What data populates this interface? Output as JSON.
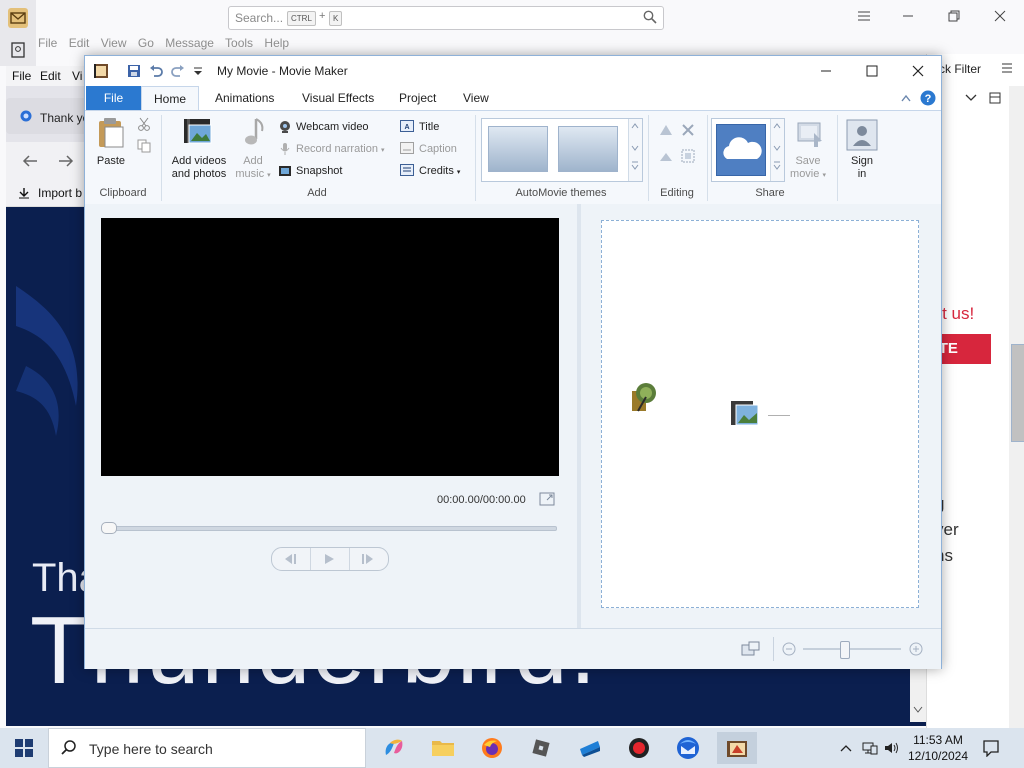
{
  "thunderbird": {
    "search_placeholder": "Search...",
    "shortcut_ctrl": "CTRL",
    "shortcut_plus": "+",
    "shortcut_k": "K",
    "menu": [
      "File",
      "Edit",
      "View",
      "Go",
      "Message",
      "Tools",
      "Help"
    ],
    "quick_filter": "ck Filter",
    "support_text": "ort us!",
    "donate_text": "ATE",
    "fragments": [
      "g",
      "ver",
      "ns"
    ]
  },
  "browser": {
    "menu": [
      "File",
      "Edit",
      "Vi"
    ],
    "tab_label": "Thank yo",
    "import_label": "Import b",
    "hero_line1": "Tha",
    "hero_line2": "Thunderbird."
  },
  "moviemaker": {
    "title": "My Movie - Movie Maker",
    "tabs": [
      "File",
      "Home",
      "Animations",
      "Visual Effects",
      "Project",
      "View"
    ],
    "clipboard": {
      "paste": "Paste",
      "group": "Clipboard"
    },
    "add": {
      "add_videos_line1": "Add videos",
      "add_videos_line2": "and photos",
      "add_music_line1": "Add",
      "add_music_line2": "music",
      "webcam": "Webcam video",
      "narration": "Record narration",
      "snapshot": "Snapshot",
      "title": "Title",
      "caption": "Caption",
      "credits": "Credits",
      "group": "Add"
    },
    "themes_group": "AutoMovie themes",
    "editing_group": "Editing",
    "share": {
      "save_line1": "Save",
      "save_line2": "movie",
      "signin_line1": "Sign",
      "signin_line2": "in",
      "group": "Share"
    },
    "timecode": "00:00.00/00:00.00"
  },
  "taskbar": {
    "search_text": "Type here to search",
    "time": "11:53 AM",
    "date": "12/10/2024"
  },
  "colors": {
    "file_tab": "#2b79d0",
    "donate": "#d7263d",
    "browser_bg": "#0b1f4f"
  }
}
